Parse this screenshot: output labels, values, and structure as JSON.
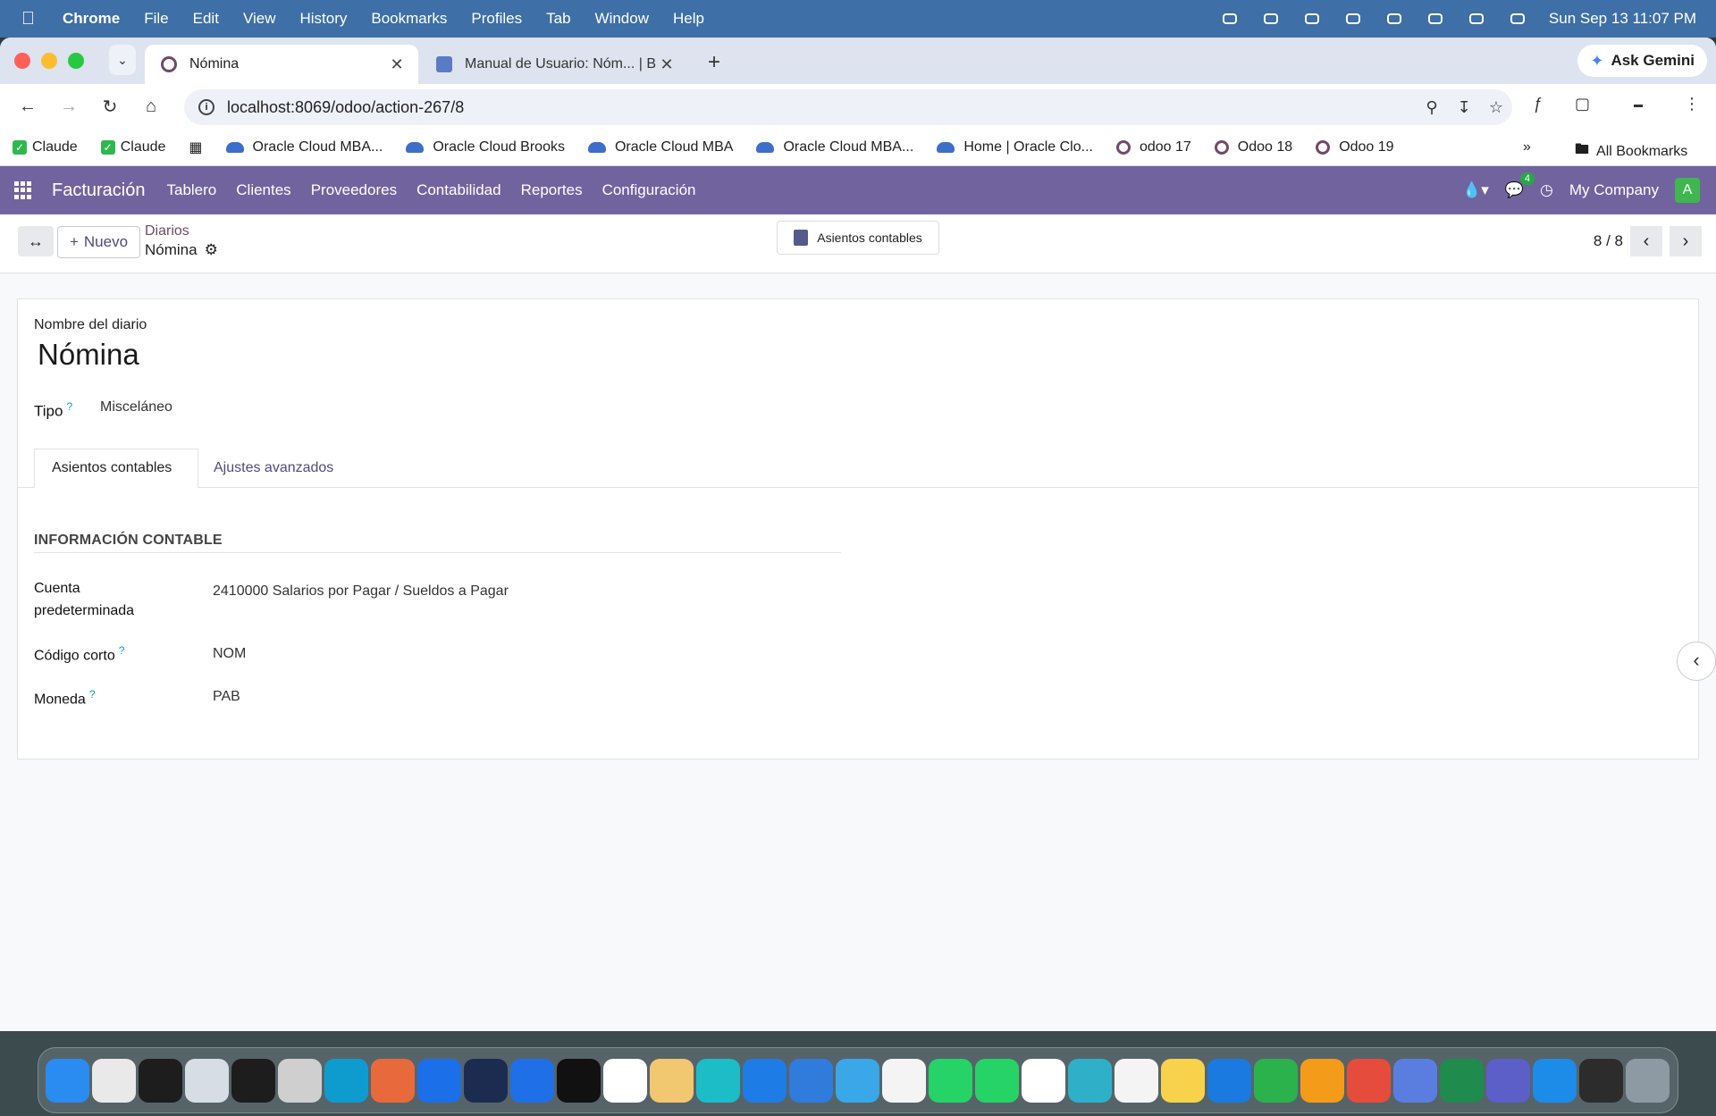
{
  "mac_menubar": {
    "app": "Chrome",
    "items": [
      "File",
      "Edit",
      "View",
      "History",
      "Bookmarks",
      "Profiles",
      "Tab",
      "Window",
      "Help"
    ],
    "clock": "Sun Sep 13  11:07 PM"
  },
  "browser": {
    "tabs": [
      {
        "title": "Nómina",
        "active": true
      },
      {
        "title": "Manual de Usuario: Nóm... | B",
        "active": false
      }
    ],
    "ask_gemini": "Ask Gemini",
    "url": "localhost:8069/odoo/action-267/8",
    "bookmarks": [
      {
        "label": "Claude",
        "icon": "check-icon"
      },
      {
        "label": "Claude",
        "icon": "check-icon"
      },
      {
        "label": "Oracle Cloud MBA...",
        "icon": "cloud-icon"
      },
      {
        "label": "Oracle Cloud Brooks",
        "icon": "cloud-icon"
      },
      {
        "label": "Oracle Cloud MBA",
        "icon": "cloud-icon"
      },
      {
        "label": "Oracle Cloud MBA...",
        "icon": "cloud-icon"
      },
      {
        "label": "Home | Oracle Clo...",
        "icon": "cloud-icon"
      },
      {
        "label": "odoo 17",
        "icon": "odoo-icon"
      },
      {
        "label": "Odoo 18",
        "icon": "odoo-icon"
      },
      {
        "label": "Odoo 19",
        "icon": "odoo-icon"
      }
    ],
    "all_bookmarks": "All Bookmarks"
  },
  "odoo": {
    "app_name": "Facturación",
    "menu": [
      "Tablero",
      "Clientes",
      "Proveedores",
      "Contabilidad",
      "Reportes",
      "Configuración"
    ],
    "messages_count": "4",
    "company": "My Company",
    "avatar_letter": "A",
    "new_button": "Nuevo",
    "breadcrumb_parent": "Diarios",
    "breadcrumb_current": "Nómina",
    "smart_button": "Asientos contables",
    "pager": "8 / 8",
    "form": {
      "name_label": "Nombre del diario",
      "name": "Nómina",
      "type_label": "Tipo",
      "type_value": "Misceláneo",
      "tabs": [
        "Asientos contables",
        "Ajustes avanzados"
      ],
      "section_title": "INFORMACIÓN CONTABLE",
      "account_label_1": "Cuenta",
      "account_label_2": "predeterminada",
      "account_value": "2410000 Salarios por Pagar / Sueldos a Pagar",
      "code_label": "Código corto",
      "code_value": "NOM",
      "currency_label": "Moneda",
      "currency_value": "PAB"
    }
  },
  "dock": {
    "icon_colors": [
      "#2a8cf0",
      "#e9e9e9",
      "#1d1d1d",
      "#d7dde4",
      "#1d1d1d",
      "#cfcfcf",
      "#0e9ccf",
      "#e86a3c",
      "#1b6fe8",
      "#1c2c50",
      "#1f6fe6",
      "#111111",
      "#ffffff",
      "#f1c76f",
      "#1dbdc7",
      "#1e7ce6",
      "#2f7cdc",
      "#3aa7e8",
      "#f4f4f4",
      "#25d366",
      "#25d366",
      "#ffffff",
      "#2fb0c9",
      "#f4f4f4",
      "#f7d24a",
      "#1a7ae0",
      "#2bb24c",
      "#f49b1a",
      "#e54c3c",
      "#5a7ee0",
      "#1f8b4c",
      "#5b5fc7",
      "#1d8be8",
      "#2c2c2c",
      "#8e9aa3"
    ]
  }
}
